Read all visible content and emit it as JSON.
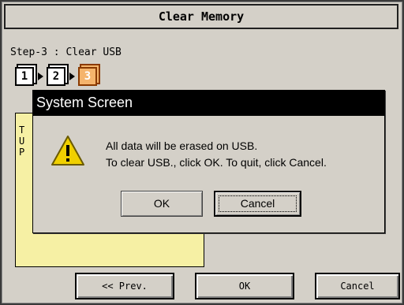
{
  "window": {
    "title": "Clear Memory"
  },
  "step": {
    "label": "Step-3 : Clear USB",
    "boxes": [
      "1",
      "2",
      "3"
    ],
    "current": "3"
  },
  "note": {
    "lines": [
      "T",
      "U",
      "P"
    ]
  },
  "buttons": {
    "prev": "<< Prev.",
    "ok": "OK",
    "cancel": "Cancel"
  },
  "dialog": {
    "title": "System Screen",
    "icon": "warning-icon",
    "line1": "All data will be erased on USB.",
    "line2": "To clear USB., click OK. To quit, click Cancel.",
    "ok": "OK",
    "cancel": "Cancel",
    "focused_button": "Cancel"
  },
  "colors": {
    "step_active": "#f5b46c",
    "note_background": "#f6f0a4",
    "dialog_titlebar": "#000000",
    "warning": "#f0d000"
  }
}
